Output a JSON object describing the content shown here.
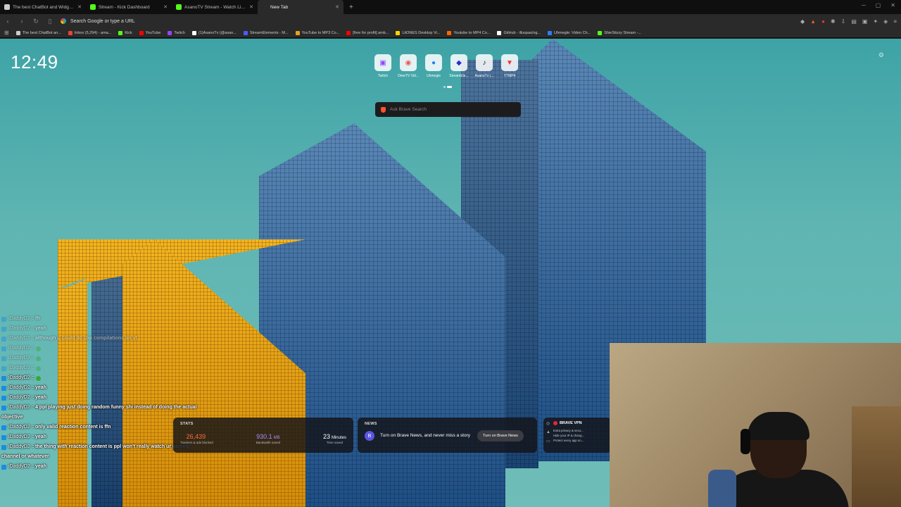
{
  "tabs": [
    {
      "title": "The best ChatBot and Widgets for Kick",
      "favicon_color": "#cccccc",
      "active": false
    },
    {
      "title": "Stream - Kick Dashboard",
      "favicon_color": "#53fc18",
      "active": false
    },
    {
      "title": "AsanoTV Stream - Watch Live on Kick",
      "favicon_color": "#53fc18",
      "active": false
    },
    {
      "title": "New Tab",
      "favicon_color": "#2a2a2a",
      "active": true
    }
  ],
  "address_bar": {
    "placeholder": "Search Google or type a URL"
  },
  "bookmarks": [
    {
      "label": "The best ChatBot an...",
      "color": "#cccccc"
    },
    {
      "label": "Inbox (5,294) - ama...",
      "color": "#ea4335"
    },
    {
      "label": "Kick",
      "color": "#53fc18"
    },
    {
      "label": "YouTube",
      "color": "#ff0000"
    },
    {
      "label": "Twitch",
      "color": "#9146ff"
    },
    {
      "label": "(1)AsanoTv (@asan...",
      "color": "#ffffff"
    },
    {
      "label": "StreamElements - M...",
      "color": "#4a5cff"
    },
    {
      "label": "YouTube to MP3 Co...",
      "color": "#e8a01f"
    },
    {
      "label": "[free for profit] amb...",
      "color": "#ff0000"
    },
    {
      "label": "LitONES Desktop Vi...",
      "color": "#ffd400"
    },
    {
      "label": "Youtube to MP4 Co...",
      "color": "#ff6600"
    },
    {
      "label": "GitHub - illuspas/ng...",
      "color": "#ffffff"
    },
    {
      "label": "Uhmegle: Video Ch...",
      "color": "#2d7cff"
    },
    {
      "label": "ShieStizzy Stream -...",
      "color": "#53fc18"
    }
  ],
  "clock": "12:49",
  "top_sites": [
    {
      "label": "Twitch",
      "icon": "twitch-icon",
      "glyph": "▣",
      "color": "#9146ff"
    },
    {
      "label": "OmeTV Vid...",
      "icon": "ometv-icon",
      "glyph": "◉",
      "color": "#e55"
    },
    {
      "label": "Uhmegle",
      "icon": "uhmegle-icon",
      "glyph": "●",
      "color": "#2d7cff"
    },
    {
      "label": "StreamEle...",
      "icon": "streamelements-icon",
      "glyph": "◆",
      "color": "#2b2bd8"
    },
    {
      "label": "AsanoTv (...",
      "icon": "tiktok-icon",
      "glyph": "♪",
      "color": "#111111"
    },
    {
      "label": "YTMP4",
      "icon": "ytmp4-icon",
      "glyph": "▼",
      "color": "#e33"
    }
  ],
  "search": {
    "placeholder": "Ask Brave Search"
  },
  "chat": [
    {
      "user": "iDaddyD2",
      "msg": ": ffr",
      "faded": true
    },
    {
      "user": "iDaddyD2",
      "msg": ": yeah",
      "faded": true
    },
    {
      "user": "iDaddyD2",
      "msg": ": although u could do clip compilations on yt",
      "faded": true
    },
    {
      "user": "iDaddyD2",
      "msg": ":",
      "emote": true,
      "faded": true
    },
    {
      "user": "iDaddyD2",
      "msg": ":",
      "emote": true,
      "faded": true
    },
    {
      "user": "iDaddyD2",
      "msg": ":",
      "emote": true,
      "faded": true
    },
    {
      "user": "iDaddyD2",
      "msg": ":",
      "emote": true,
      "faded": false
    },
    {
      "user": "iDaddyD2",
      "msg": ": yeah",
      "faded": false
    },
    {
      "user": "iDaddyD2",
      "msg": ": yeah",
      "faded": false
    },
    {
      "user": "iDaddyD2",
      "msg": ": 4 ppl playing just doing random funny shi instead of doing the actual",
      "faded": false
    },
    {
      "user": "",
      "msg": "objective",
      "cont": true,
      "faded": false
    },
    {
      "user": "iDaddyD2",
      "msg": ": only valid reaction content is ffn",
      "faded": false
    },
    {
      "user": "iDaddyD2",
      "msg": ": yeah",
      "faded": false
    },
    {
      "user": "iDaddyD2",
      "msg": ": the thing with reaction content is ppl won't really watch ur gaming",
      "faded": false
    },
    {
      "user": "",
      "msg": "channel or whatever",
      "cont": true,
      "faded": false
    },
    {
      "user": "iDaddyD2",
      "msg": ": yeah",
      "faded": false
    }
  ],
  "stats_widget": {
    "heading": "STATS",
    "items": [
      {
        "value": "26,439",
        "unit": "",
        "label": "Trackers & ads blocked",
        "color": "#ff6a3d"
      },
      {
        "value": "930.1",
        "unit": "MB",
        "label": "Bandwidth saved",
        "color": "#a78bfa"
      },
      {
        "value": "23",
        "unit": "Minutes",
        "label": "Time saved",
        "color": "#ffffff"
      }
    ]
  },
  "news_widget": {
    "heading": "NEWS",
    "text": "Turn on Brave News, and never miss a story",
    "button": "Turn on Brave News"
  },
  "vpn_widget": {
    "heading": "BRAVE VPN",
    "lines": [
      "Extra privacy & secu...",
      "Hide your IP & chang...",
      "Protect every app on..."
    ]
  }
}
